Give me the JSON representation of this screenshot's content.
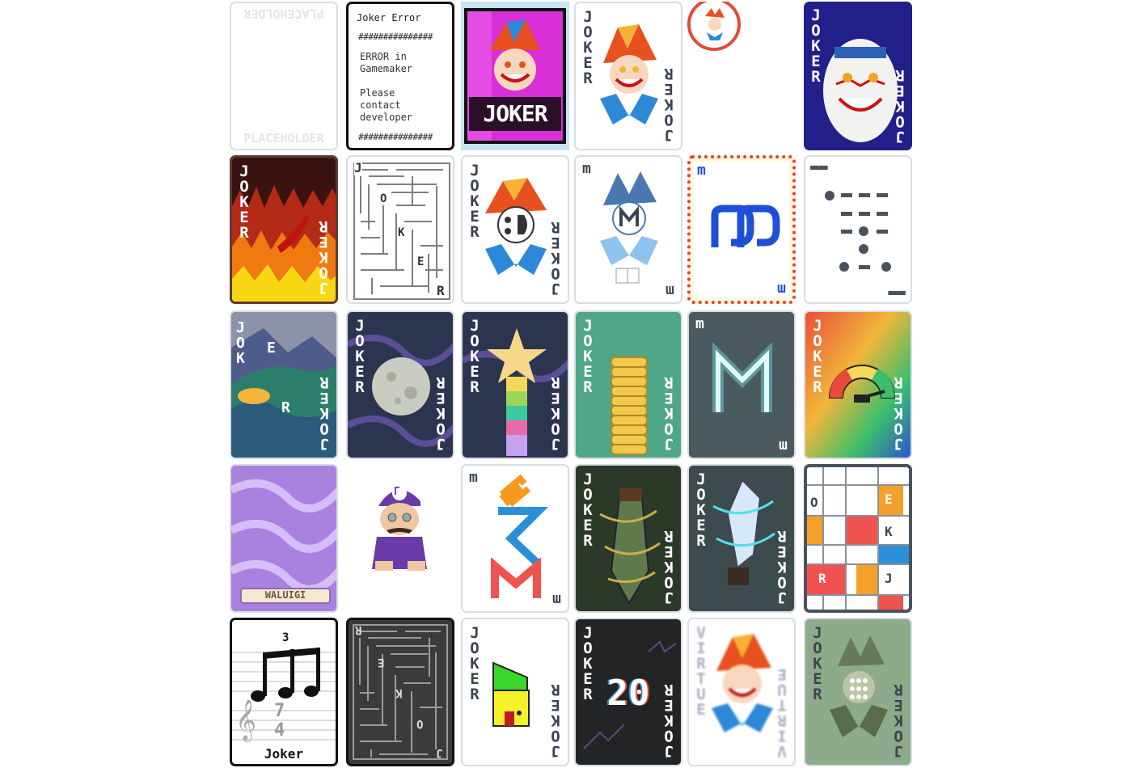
{
  "placeholder": {
    "top": "PLACEHOLDER",
    "bottom": "PLACEHOLDER"
  },
  "error": {
    "title": "Joker Error",
    "hashes": "###############",
    "line1": "ERROR in",
    "line2": "Gamemaker",
    "line3": "Please",
    "line4": "contact",
    "line5": "developer"
  },
  "joker_pack": {
    "banner": "JOKER"
  },
  "labels": {
    "joker": "JOKER",
    "jok": "JOK",
    "e": "E",
    "r": "R",
    "m": "m",
    "w": "w",
    "virtue": "VIRTUE"
  },
  "maze": {
    "j": "J",
    "o": "O",
    "k": "K",
    "e": "E",
    "r": "R"
  },
  "morse": {
    "dash_pair": "▬▬"
  },
  "mondrian": {
    "o": "O",
    "e": "E",
    "k": "K",
    "r": "R",
    "j": "J"
  },
  "wario": {
    "banner": "WALUIGI",
    "cap": "Γ"
  },
  "music": {
    "tuplet": "3",
    "time_top": "7",
    "time_bottom": "4",
    "label": "Joker",
    "clef": "𝄞"
  },
  "twenty": {
    "value": "20"
  },
  "colors": {
    "joker_gray": "#3b4350",
    "card_border": "#d7dde3",
    "morse_gray": "#4a535c",
    "mondrian_red": "#f0524f",
    "mondrian_orange": "#f4a02a",
    "mondrian_blue": "#2b8fd8",
    "m_blue": "#1f4fd8"
  }
}
